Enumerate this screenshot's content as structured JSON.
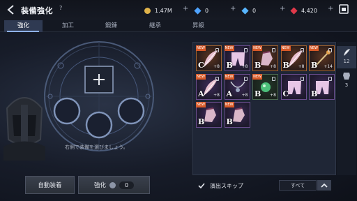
{
  "header": {
    "title": "装備強化",
    "help": "?",
    "resources": [
      {
        "name": "gold",
        "value": "1.47M",
        "color": "#e0b34a"
      },
      {
        "name": "blue-gem",
        "value": "0",
        "color": "#4fa3ff"
      },
      {
        "name": "blue-crystal",
        "value": "0",
        "color": "#58b6ff"
      },
      {
        "name": "red-gem",
        "value": "4,420",
        "color": "#e0394a"
      }
    ],
    "plus": "+"
  },
  "tabs": [
    "強化",
    "加工",
    "鍛錬",
    "継承",
    "昇級"
  ],
  "hint": "右側で装備を選びましょう。",
  "buttons": {
    "auto_equip": "自動装着",
    "enhance": "強化",
    "enhance_count": "0"
  },
  "inventory": {
    "items": [
      {
        "grade": "C",
        "plus": "+8",
        "new": true,
        "lock": true,
        "rarity": "orange",
        "icon": "feather-icon"
      },
      {
        "grade": "B",
        "plus": "+8",
        "new": true,
        "lock": true,
        "rarity": "purple",
        "icon": "pants-icon"
      },
      {
        "grade": "B",
        "plus": "+8",
        "new": true,
        "lock": true,
        "rarity": "orange",
        "icon": "gloves-icon"
      },
      {
        "grade": "B",
        "plus": "+8",
        "new": true,
        "lock": true,
        "rarity": "orange",
        "icon": "feather-icon"
      },
      {
        "grade": "B",
        "plus": "+14",
        "new": true,
        "lock": true,
        "rarity": "orange",
        "icon": "staff-icon"
      },
      {
        "grade": "A",
        "plus": "+8",
        "new": true,
        "lock": true,
        "rarity": "purple",
        "icon": "feather-icon"
      },
      {
        "grade": "A",
        "plus": "+8",
        "new": true,
        "lock": true,
        "rarity": "purple",
        "icon": "necklace-icon"
      },
      {
        "grade": "B",
        "plus": "+8",
        "new": true,
        "lock": true,
        "rarity": "green",
        "icon": "orb-icon"
      },
      {
        "grade": "C",
        "plus": "",
        "new": false,
        "lock": true,
        "rarity": "purple",
        "icon": "pants-icon"
      },
      {
        "grade": "B",
        "plus": "",
        "new": false,
        "lock": true,
        "rarity": "purple",
        "icon": "pants-icon"
      },
      {
        "grade": "B",
        "plus": "",
        "new": true,
        "lock": false,
        "rarity": "purple",
        "icon": "gloves-icon"
      },
      {
        "grade": "B",
        "plus": "",
        "new": true,
        "lock": false,
        "rarity": "purple",
        "icon": "gloves-icon"
      }
    ],
    "badge": "NEW"
  },
  "side_tabs": [
    {
      "icon": "feather-icon",
      "count": "12"
    },
    {
      "icon": "armor-icon",
      "count": "3"
    }
  ],
  "footer": {
    "skip_label": "演出スキップ",
    "sort_label": "すべて"
  }
}
